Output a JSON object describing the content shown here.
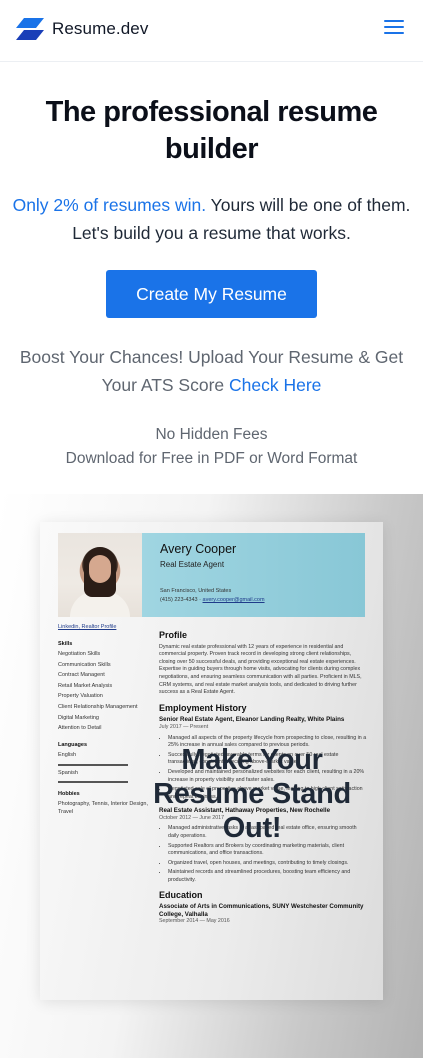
{
  "header": {
    "brand_name": "Resume.dev",
    "logo_icon": "resume-dev-logo",
    "menu_icon": "hamburger-menu-icon",
    "accent_color": "#1a73e8"
  },
  "hero": {
    "title": "The professional resume builder",
    "subtitle_highlight": "Only 2% of resumes win.",
    "subtitle_rest": "Yours will be one of them. Let's build you a resume that works.",
    "cta_label": "Create My Resume"
  },
  "ats": {
    "text": "Boost Your Chances! Upload Your Resume & Get Your ATS Score",
    "link": "Check Here"
  },
  "fees": {
    "line1": "No Hidden Fees",
    "line2": "Download for Free in PDF or Word Format"
  },
  "showcase": {
    "overlay_title": "Make Your Resume Stand Out!",
    "resume": {
      "name": "Avery Cooper",
      "role": "Real Estate Agent",
      "location": "San Francisco, United States",
      "phone": "(415) 223-4343",
      "email": "avery.cooper@gmail.com",
      "links": "Linkedin, Realtor Profile",
      "skills_title": "Skills",
      "skills": [
        "Negotiation Skills",
        "Communication Skills",
        "Contract Managent",
        "Retail Market Analysis",
        "Property Valuation",
        "Client Relationship Management",
        "Digital Marketing",
        "Attention to Detail"
      ],
      "languages_title": "Languages",
      "languages": [
        "English",
        "Spanish"
      ],
      "hobbies_title": "Hobbies",
      "hobbies": "Photography, Tennis, Interior Design, Travel",
      "profile_title": "Profile",
      "profile_text": "Dynamic real estate professional with 12 years of experience in residential and commercial property. Proven track record in developing strong client relationships, closing over 50 successful deals, and providing exceptional real estate experiences. Expertise in guiding buyers through home visits, advocating for clients during complex negotiations, and ensuring seamless communication with all parties. Proficient in MLS, CRM systems, and real estate market analysis tools, and dedicated to driving further success as a Real Estate Agent.",
      "employment_title": "Employment History",
      "job1_title": "Senior Real Estate Agent, Eleanor Landing Realty, White Plains",
      "job1_date": "July 2017 — Present",
      "job1_bullets": [
        "Managed all aspects of the property lifecycle from prospecting to close, resulting in a 25% increase in annual sales compared to previous periods.",
        "Successfully negotiated favorable terms for clients on over 50 real estate transactions, consistently securing above-market value.",
        "Developed and maintained personalized websites for each client, resulting in a 20% increase in property visibility and faster sales.",
        "Negotiated sale of properties above market value, leading to high client satisfaction and repeat business."
      ],
      "job2_title": "Real Estate Assistant, Hathaway Properties, New Rochelle",
      "job2_date": "October 2012 — June 2017",
      "job2_bullets": [
        "Managed administrative tasks in a fast-paced real estate office, ensuring smooth daily operations.",
        "Supported Realtors and Brokers by coordinating marketing materials, client communications, and office transactions.",
        "Organized travel, open houses, and meetings, contributing to timely closings.",
        "Maintained records and streamlined procedures, boosting team efficiency and productivity."
      ],
      "education_title": "Education",
      "edu_title": "Associate of Arts in Communications, SUNY Westchester Community College, Valhalla",
      "edu_date": "September 2014 — May 2016"
    }
  }
}
